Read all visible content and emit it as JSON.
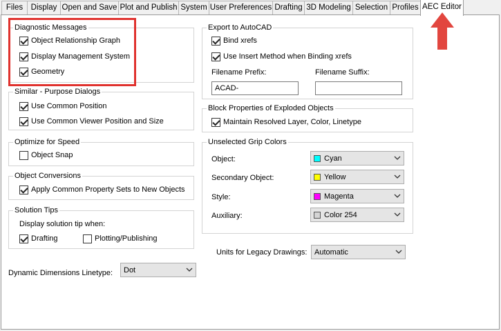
{
  "tabs": [
    {
      "label": "Files",
      "active": false
    },
    {
      "label": "Display",
      "active": false
    },
    {
      "label": "Open and Save",
      "active": false
    },
    {
      "label": "Plot and Publish",
      "active": false
    },
    {
      "label": "System",
      "active": false
    },
    {
      "label": "User Preferences",
      "active": false
    },
    {
      "label": "Drafting",
      "active": false
    },
    {
      "label": "3D Modeling",
      "active": false
    },
    {
      "label": "Selection",
      "active": false
    },
    {
      "label": "Profiles",
      "active": false
    },
    {
      "label": "AEC Editor",
      "active": true
    }
  ],
  "diagnostic": {
    "title": "Diagnostic Messages",
    "items": [
      {
        "label": "Object Relationship Graph",
        "checked": true
      },
      {
        "label": "Display Management System",
        "checked": true
      },
      {
        "label": "Geometry",
        "checked": true
      }
    ]
  },
  "similar": {
    "title": "Similar - Purpose Dialogs",
    "items": [
      {
        "label": "Use Common Position",
        "checked": true
      },
      {
        "label": "Use Common Viewer Position and Size",
        "checked": true
      }
    ]
  },
  "optimize": {
    "title": "Optimize for Speed",
    "items": [
      {
        "label": "Object Snap",
        "checked": false
      }
    ]
  },
  "conversions": {
    "title": "Object Conversions",
    "items": [
      {
        "label": "Apply Common Property Sets to New Objects",
        "checked": true
      }
    ]
  },
  "solution": {
    "title": "Solution Tips",
    "prompt": "Display solution tip when:",
    "items": [
      {
        "label": "Drafting",
        "checked": true
      },
      {
        "label": "Plotting/Publishing",
        "checked": false
      }
    ]
  },
  "dimensions": {
    "label": "Dynamic Dimensions Linetype:",
    "value": "Dot"
  },
  "export": {
    "title": "Export to AutoCAD",
    "items": [
      {
        "label": "Bind xrefs",
        "checked": true
      },
      {
        "label": "Use Insert Method when Binding xrefs",
        "checked": true
      }
    ],
    "prefix_label": "Filename Prefix:",
    "prefix_value": "ACAD-",
    "suffix_label": "Filename Suffix:",
    "suffix_value": ""
  },
  "block": {
    "title": "Block Properties of Exploded Objects",
    "items": [
      {
        "label": "Maintain Resolved Layer, Color, Linetype",
        "checked": true
      }
    ]
  },
  "grip": {
    "title": "Unselected Grip Colors",
    "rows": [
      {
        "label": "Object:",
        "value": "Cyan",
        "color": "#00ffff"
      },
      {
        "label": "Secondary Object:",
        "value": "Yellow",
        "color": "#ffff00"
      },
      {
        "label": "Style:",
        "value": "Magenta",
        "color": "#ff00ff"
      },
      {
        "label": "Auxiliary:",
        "value": "Color 254",
        "color": "#d4d4d4"
      }
    ]
  },
  "legacy": {
    "label": "Units for Legacy Drawings:",
    "value": "Automatic"
  },
  "annotation_color": "#e0322e"
}
